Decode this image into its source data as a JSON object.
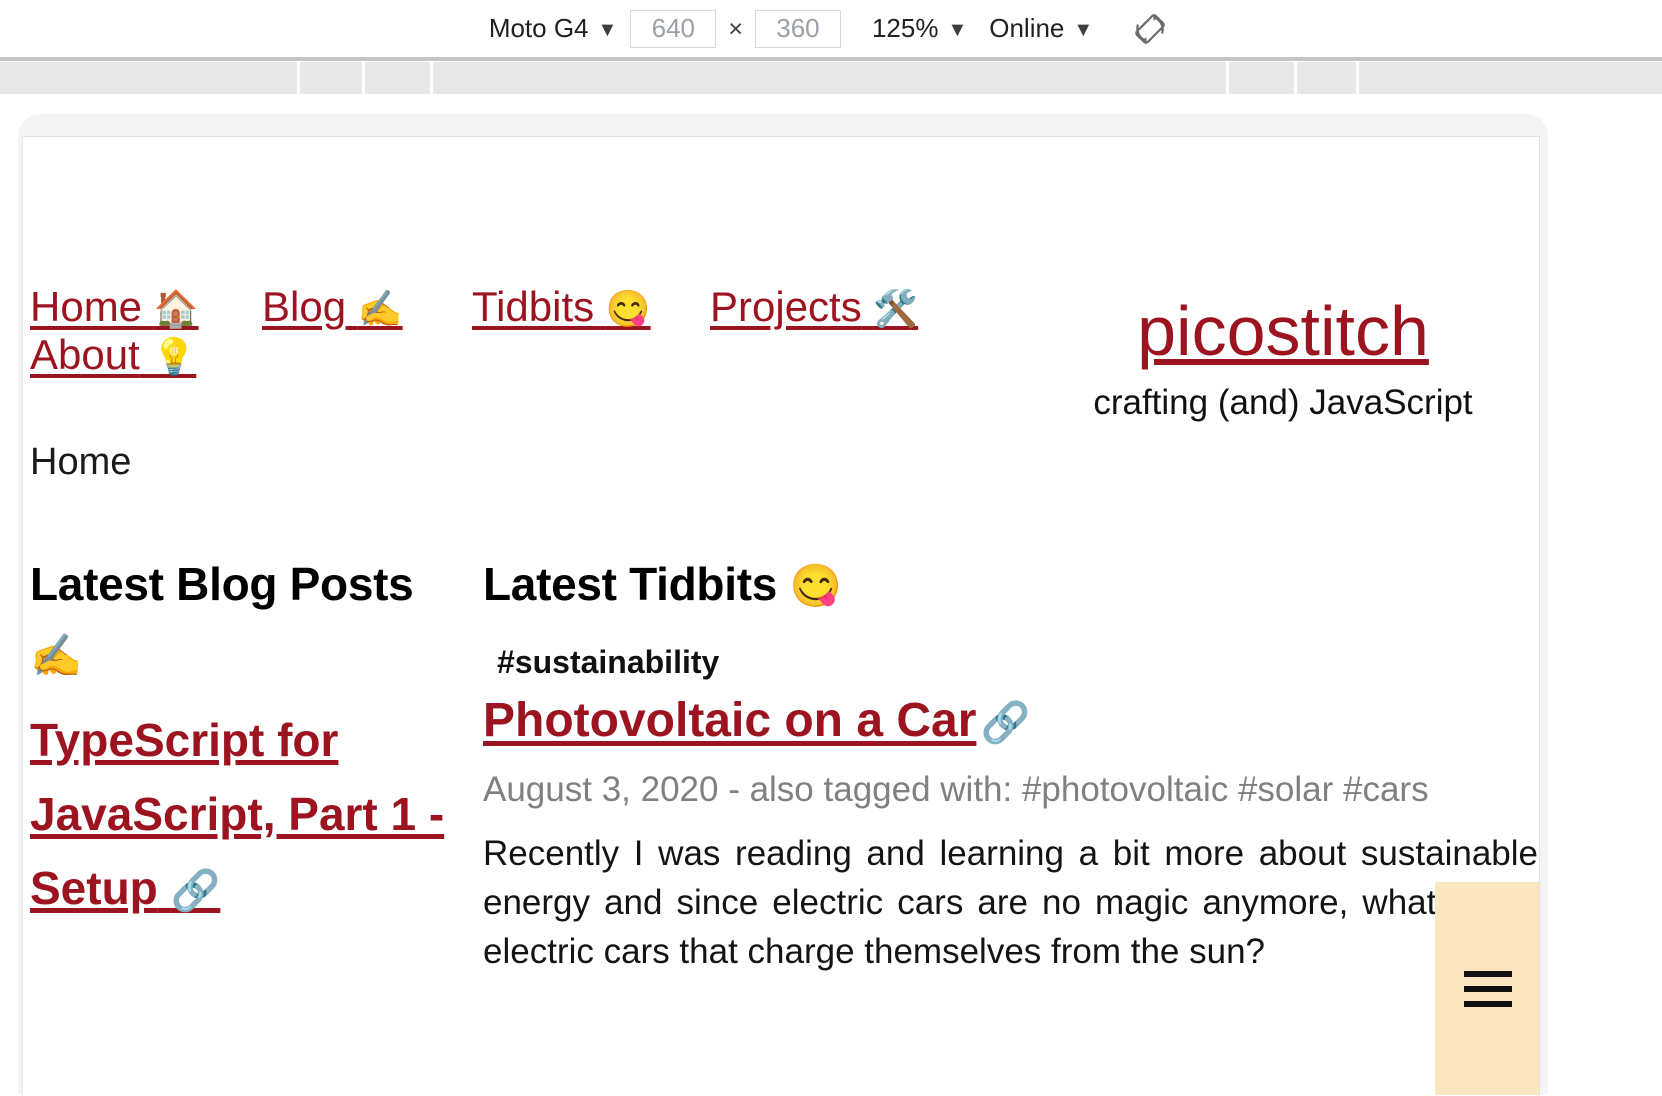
{
  "devtools": {
    "device": "Moto G4",
    "width_value": "640",
    "height_value": "360",
    "dim_separator": "×",
    "zoom": "125%",
    "throttling": "Online",
    "caret": "▼",
    "rotate_icon": "rotate-device-icon"
  },
  "site": {
    "nav": [
      {
        "label": "Home",
        "emoji": "🏠",
        "name": "nav-link-home"
      },
      {
        "label": "Blog",
        "emoji": "✍️",
        "name": "nav-link-blog"
      },
      {
        "label": "Tidbits",
        "emoji": "😋",
        "name": "nav-link-tidbits"
      },
      {
        "label": "Projects",
        "emoji": "🛠️",
        "name": "nav-link-projects"
      },
      {
        "label": "About",
        "emoji": "💡",
        "name": "nav-link-about"
      }
    ],
    "brand_title": "picostitch",
    "brand_tagline": "crafting (and) JavaScript",
    "breadcrumb": "Home",
    "brand_color": "#9c1420"
  },
  "blog": {
    "heading_text": "Latest Blog Posts",
    "heading_emoji": "✍️",
    "post_title": "TypeScript for JavaScript, Part 1 - Setup",
    "post_anchor_emoji": "🔗"
  },
  "tidbits": {
    "heading_text": "Latest Tidbits",
    "heading_emoji": "😋",
    "tag": "#sustainability",
    "title": "Photovoltaic on a Car",
    "anchor_emoji": "🔗",
    "meta": "August 3, 2020 - also tagged with: #photovoltaic #solar #cars",
    "body": "Recently I was reading and learning a bit more about sustainable energy and since electric cars are no magic anymore, what about electric cars that charge themselves from the sun?"
  },
  "fab": {
    "icon": "hamburger-menu-icon",
    "color": "#fce6c0"
  }
}
